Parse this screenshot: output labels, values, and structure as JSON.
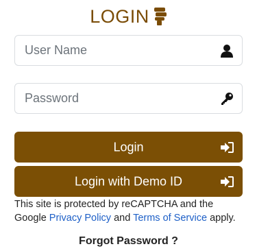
{
  "header": {
    "title": "LOGIN",
    "icon": "thumbs-up-icon"
  },
  "form": {
    "username": {
      "placeholder": "User Name",
      "value": "",
      "icon": "user-icon"
    },
    "password": {
      "placeholder": "Password",
      "value": "",
      "icon": "key-icon"
    }
  },
  "buttons": {
    "login_label": "Login",
    "demo_label": "Login with Demo ID",
    "icon": "sign-in-icon"
  },
  "recaptcha": {
    "text_before": "This site is protected by reCAPTCHA and the Google",
    "privacy_link": "Privacy Policy",
    "and_text": "and",
    "terms_link": "Terms of Service",
    "text_after": "apply."
  },
  "forgot_password": "Forgot Password ?",
  "colors": {
    "brand": "#7b4f05",
    "link": "#1d5fc7"
  }
}
